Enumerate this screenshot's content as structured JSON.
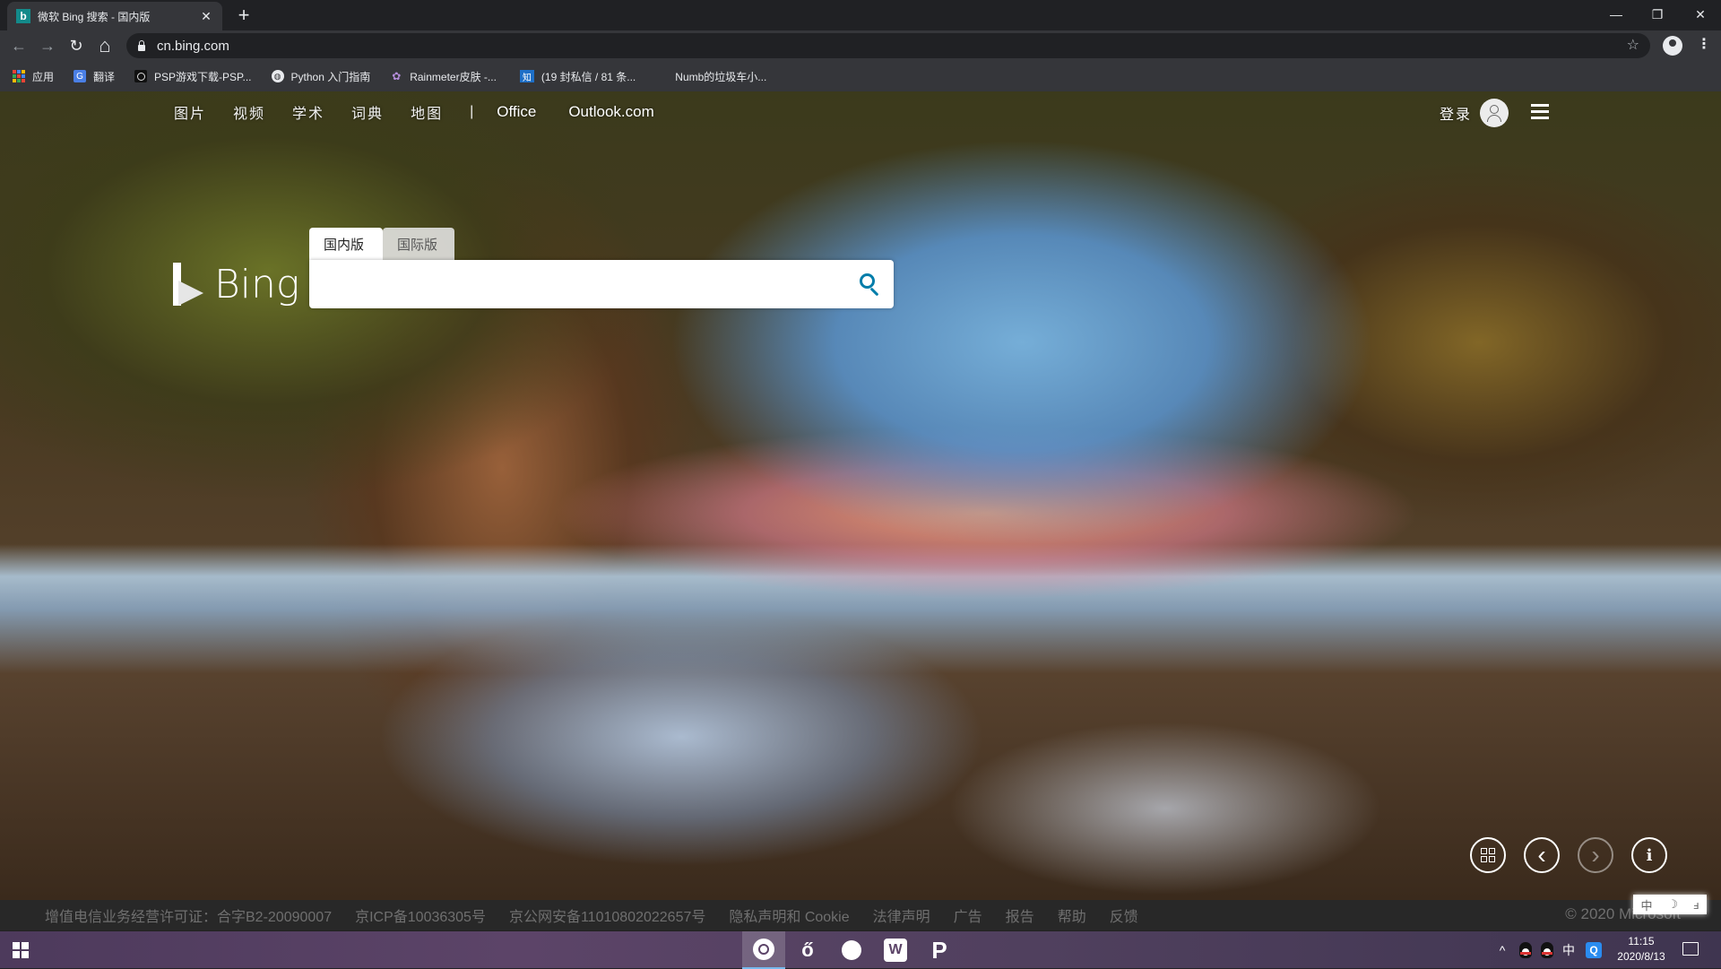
{
  "browser": {
    "tab": {
      "title": "微软 Bing 搜索 - 国内版",
      "favicon": "b",
      "close": "✕"
    },
    "new_tab": "+",
    "window_controls": {
      "minimize": "—",
      "restore": "❐",
      "close": "✕"
    },
    "nav": {
      "back": "←",
      "forward": "→",
      "reload": "↻",
      "home": "⌂"
    },
    "url": "cn.bing.com",
    "star": "☆",
    "menu": "⋮",
    "bookmarks": [
      {
        "label": "应用",
        "icon": "apps-grid-icon"
      },
      {
        "label": "翻译",
        "icon": "google-translate-icon"
      },
      {
        "label": "PSP游戏下载-PSP...",
        "icon": "circle-icon"
      },
      {
        "label": "Python 入门指南",
        "icon": "globe-icon"
      },
      {
        "label": "Rainmeter皮肤 -...",
        "icon": "rainmeter-icon"
      },
      {
        "label": "(19 封私信 / 81 条...",
        "icon": "zhihu-icon",
        "icon_text": "知"
      },
      {
        "label": "Numb的垃圾车小...",
        "icon": "none"
      }
    ]
  },
  "bing": {
    "nav": {
      "items_cn": [
        "图片",
        "视频",
        "学术",
        "词典",
        "地图"
      ],
      "separator": "|",
      "items_en": [
        "Office",
        "Outlook.com"
      ]
    },
    "login": "登录",
    "logo_text": "Bing",
    "scope_tabs": {
      "domestic": "国内版",
      "international": "国际版",
      "active": "国内版"
    },
    "search": {
      "value": "",
      "placeholder": ""
    },
    "controls": {
      "qr": "qr-code",
      "prev": "‹",
      "next": "›",
      "info": "i"
    },
    "ime": [
      "中",
      "☽",
      "ⅎ"
    ],
    "footer": {
      "links": [
        "增值电信业务经营许可证：合字B2-20090007",
        "京ICP备10036305号",
        "京公网安备11010802022657号",
        "隐私声明和 Cookie",
        "法律声明",
        "广告",
        "报告",
        "帮助",
        "反馈"
      ],
      "copyright": "© 2020 Microsoft"
    }
  },
  "taskbar": {
    "apps": [
      "Chrome",
      "NetEase Music",
      "QQ Browser",
      "W",
      "P"
    ],
    "tray": {
      "chevron": "^",
      "ime": "中",
      "q": "Q"
    },
    "time": "11:15",
    "date": "2020/8/13"
  }
}
